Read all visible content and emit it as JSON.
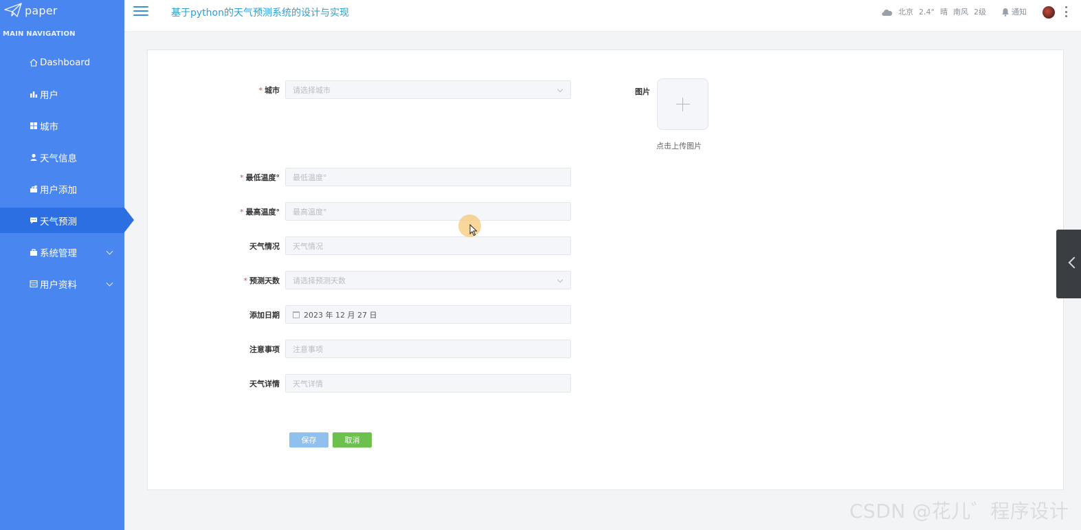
{
  "sidebar": {
    "logo_text": "paper",
    "nav_header": "MAIN NAVIGATION",
    "items": [
      {
        "label": "Dashboard",
        "icon": "home-icon"
      },
      {
        "label": "用户",
        "icon": "bar-chart-icon"
      },
      {
        "label": "城市",
        "icon": "grid-icon"
      },
      {
        "label": "天气信息",
        "icon": "user-icon"
      },
      {
        "label": "用户添加",
        "icon": "user-add-icon"
      },
      {
        "label": "天气预测",
        "icon": "comment-icon",
        "active": true
      },
      {
        "label": "系统管理",
        "icon": "briefcase-icon",
        "expandable": true
      },
      {
        "label": "用户资料",
        "icon": "profile-card-icon",
        "expandable": true
      }
    ]
  },
  "header": {
    "title": "基于python的天气预测系统的设计与实现",
    "weather": {
      "city": "北京",
      "temp": "2.4°",
      "condition": "晴",
      "wind": "南风",
      "level": "2级"
    },
    "notify_label": "通知"
  },
  "form": {
    "city": {
      "label": "城市",
      "required": true,
      "placeholder": "请选择城市"
    },
    "image": {
      "label": "图片",
      "hint": "点击上传图片"
    },
    "min_temp": {
      "label": "最低温度°",
      "required": true,
      "placeholder": "最低温度°"
    },
    "max_temp": {
      "label": "最高温度°",
      "required": true,
      "placeholder": "最高温度°"
    },
    "condition": {
      "label": "天气情况",
      "placeholder": "天气情况"
    },
    "forecast_days": {
      "label": "预测天数",
      "required": true,
      "placeholder": "请选择预测天数"
    },
    "add_date": {
      "label": "添加日期",
      "value": "2023 年 12 月 27 日"
    },
    "notes": {
      "label": "注意事项",
      "placeholder": "注意事项"
    },
    "detail": {
      "label": "天气详情",
      "placeholder": "天气详情"
    },
    "save_label": "保存",
    "cancel_label": "取消"
  },
  "watermark": "CSDN @花儿゛程序设计",
  "colors": {
    "sidebar": "#4a86f0",
    "active": "#2b6fe3",
    "title": "#2aa0d6",
    "save": "#8fc0ee",
    "cancel": "#6cc14e",
    "required": "#e4464a"
  }
}
